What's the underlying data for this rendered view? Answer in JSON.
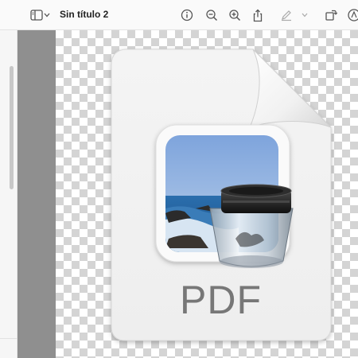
{
  "window": {
    "title": "Sin título 2"
  },
  "toolbar": {
    "items": [
      {
        "name": "sidebar-toggle-icon"
      },
      {
        "name": "chevron-down-icon"
      },
      {
        "name": "info-icon"
      },
      {
        "name": "zoom-out-icon"
      },
      {
        "name": "zoom-in-icon"
      },
      {
        "name": "share-icon"
      },
      {
        "name": "highlight-pen-icon"
      },
      {
        "name": "rotate-icon"
      },
      {
        "name": "markup-icon"
      }
    ]
  },
  "document": {
    "icon_label": "PDF",
    "icon_name": "preview-pdf-document-icon"
  },
  "colors": {
    "page_margin": "#8f8f8f",
    "checker": "#d4d4d4",
    "pdf_text": "#777777",
    "sky": "#8fb2e0",
    "sea": "#1f5f9a"
  }
}
